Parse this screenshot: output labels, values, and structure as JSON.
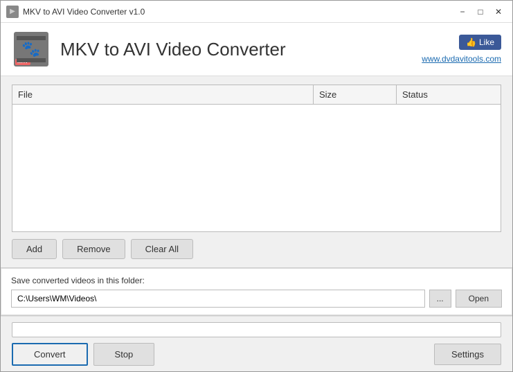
{
  "titlebar": {
    "title": "MKV to AVI Video Converter v1.0",
    "minimize_label": "−",
    "maximize_label": "□",
    "close_label": "✕"
  },
  "header": {
    "app_title": "MKV to AVI Video Converter",
    "like_button": "Like",
    "website_url": "www.dvdavitools.com"
  },
  "table": {
    "col_file": "File",
    "col_size": "Size",
    "col_status": "Status"
  },
  "buttons": {
    "add": "Add",
    "remove": "Remove",
    "clear_all": "Clear All",
    "open": "Open",
    "browse": "...",
    "convert": "Convert",
    "stop": "Stop",
    "settings": "Settings"
  },
  "save": {
    "label": "Save converted videos in this folder:",
    "path": "C:\\Users\\WM\\Videos\\"
  },
  "progress": {
    "value": 0
  }
}
